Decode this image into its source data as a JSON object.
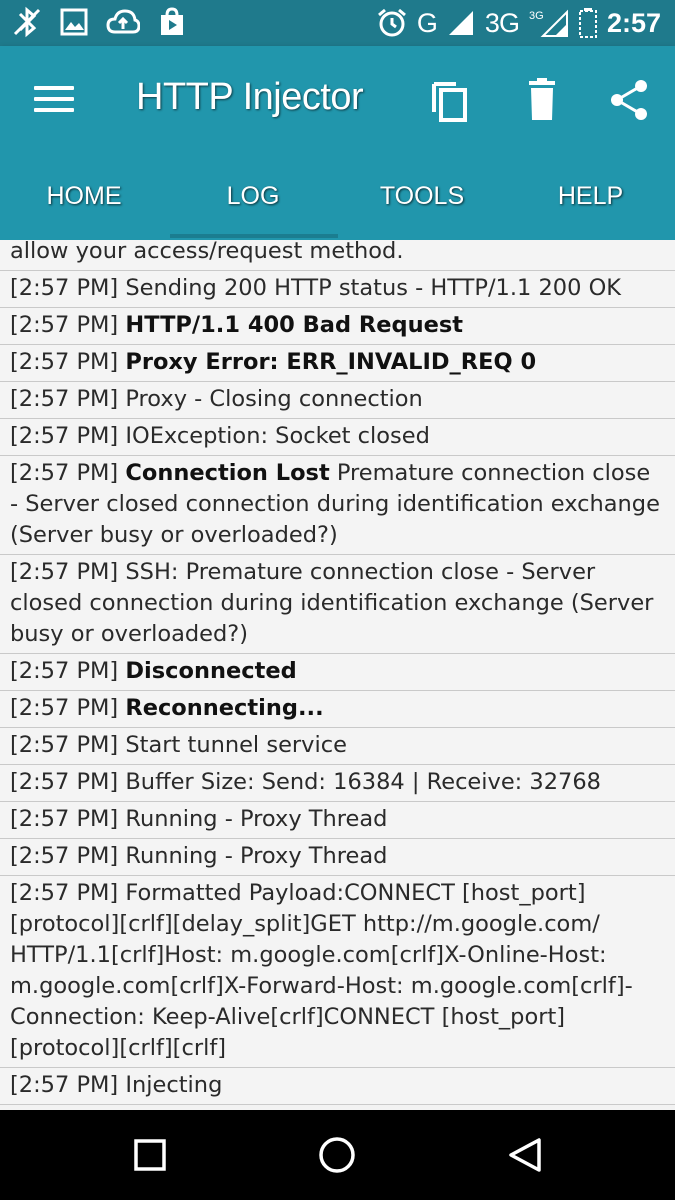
{
  "status_bar": {
    "network_text": "G",
    "network_text2": "3G",
    "network_sup": "3G",
    "time": "2:57"
  },
  "app_bar": {
    "title": "HTTP Injector"
  },
  "tabs": [
    {
      "label": "HOME"
    },
    {
      "label": "LOG"
    },
    {
      "label": "TOOLS"
    },
    {
      "label": "HELP"
    }
  ],
  "log": [
    {
      "prefix": "",
      "bold": "",
      "text": "allow your access/request method."
    },
    {
      "prefix": "[2:57 PM] ",
      "bold": "",
      "text": "Sending 200 HTTP status - HTTP/1.1 200 OK"
    },
    {
      "prefix": "[2:57 PM] ",
      "bold": "HTTP/1.1 400 Bad Request",
      "text": ""
    },
    {
      "prefix": "[2:57 PM] ",
      "bold": "Proxy Error: ERR_INVALID_REQ 0",
      "text": ""
    },
    {
      "prefix": "[2:57 PM] ",
      "bold": "",
      "text": "Proxy - Closing connection"
    },
    {
      "prefix": "[2:57 PM] ",
      "bold": "",
      "text": "IOException: Socket closed"
    },
    {
      "prefix": "[2:57 PM] ",
      "bold": "Connection Lost",
      "text": " Premature connection close - Server closed connection during identification exchange (Server busy or overloaded?)"
    },
    {
      "prefix": "[2:57 PM] ",
      "bold": "",
      "text": "SSH: Premature connection close - Server closed connection during identification exchange (Server busy or overloaded?)"
    },
    {
      "prefix": "[2:57 PM] ",
      "bold": "Disconnected",
      "text": ""
    },
    {
      "prefix": "[2:57 PM] ",
      "bold": "Reconnecting...",
      "text": ""
    },
    {
      "prefix": "[2:57 PM] ",
      "bold": "",
      "text": "Start tunnel service"
    },
    {
      "prefix": "[2:57 PM] ",
      "bold": "",
      "text": "Buffer Size: Send: 16384 | Receive: 32768"
    },
    {
      "prefix": "[2:57 PM] ",
      "bold": "",
      "text": "Running - Proxy Thread"
    },
    {
      "prefix": "[2:57 PM] ",
      "bold": "",
      "text": "Running - Proxy Thread"
    },
    {
      "prefix": "[2:57 PM] ",
      "bold": "",
      "text": "Formatted Payload:CONNECT [host_port][protocol][crlf][delay_split]GET http://m.google.com/ HTTP/1.1[crlf]Host: m.google.com[crlf]X-Online-Host: m.google.com[crlf]X-Forward-Host: m.google.com[crlf]-Connection: Keep-Alive[crlf]CONNECT [host_port][protocol][crlf][crlf]"
    },
    {
      "prefix": "[2:57 PM] ",
      "bold": "",
      "text": "Injecting"
    }
  ],
  "colors": {
    "status_bar": "#1f7a8c",
    "app_bar": "#2196ac",
    "log_background": "#f4f4f4",
    "nav_bar": "#000000"
  },
  "icons": {
    "status_left": [
      "no-bluetooth-icon",
      "image-icon",
      "cloud-upload-icon",
      "play-store-icon"
    ],
    "status_right": [
      "alarm-icon",
      "signal-icon",
      "signal-icon",
      "battery-icon"
    ],
    "app_bar": [
      "menu-icon",
      "copy-icon",
      "trash-icon",
      "share-icon"
    ],
    "nav_bar": [
      "recents-icon",
      "home-icon",
      "back-icon"
    ]
  }
}
